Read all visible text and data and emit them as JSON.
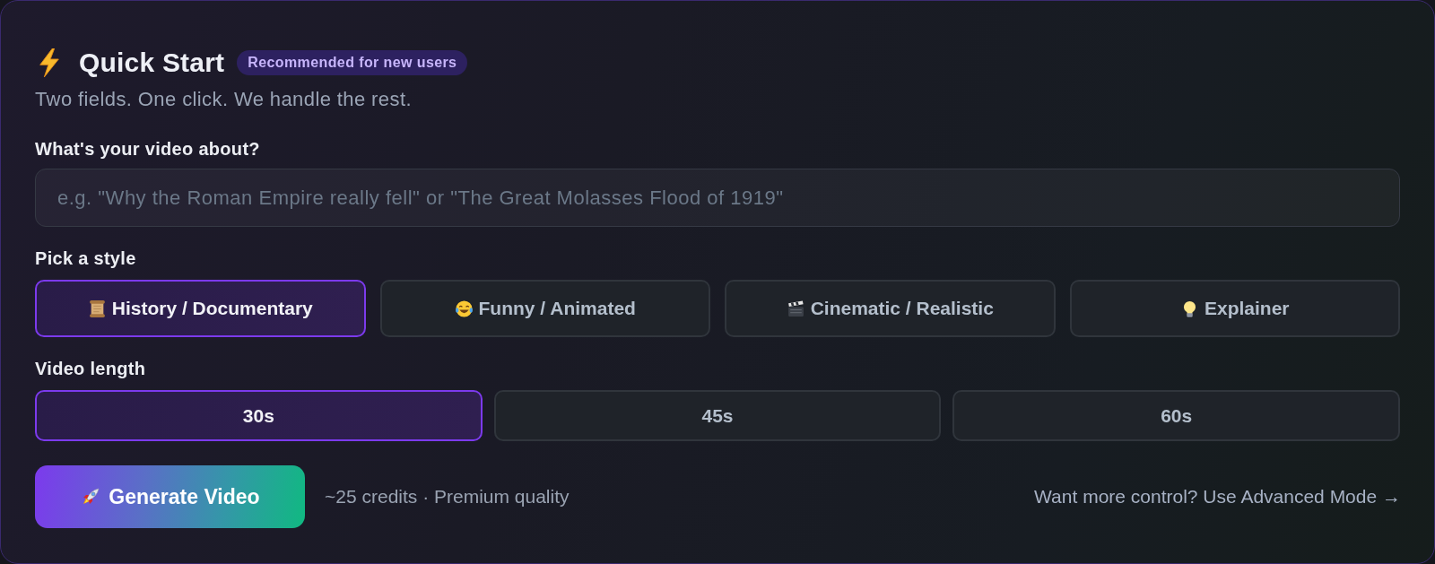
{
  "header": {
    "title": "Quick Start",
    "badge": "Recommended for new users",
    "subtitle": "Two fields. One click. We handle the rest."
  },
  "topic": {
    "label": "What's your video about?",
    "placeholder": "e.g. \"Why the Roman Empire really fell\" or \"The Great Molasses Flood of 1919\""
  },
  "style": {
    "label": "Pick a style",
    "options": [
      {
        "label": "History / Documentary",
        "selected": true
      },
      {
        "label": "Funny / Animated",
        "selected": false
      },
      {
        "label": "Cinematic / Realistic",
        "selected": false
      },
      {
        "label": "Explainer",
        "selected": false
      }
    ]
  },
  "length": {
    "label": "Video length",
    "options": [
      {
        "label": "30s",
        "selected": true
      },
      {
        "label": "45s",
        "selected": false
      },
      {
        "label": "60s",
        "selected": false
      }
    ]
  },
  "footer": {
    "generate_button": "Generate Video",
    "cost_note": "~25 credits · Premium quality",
    "advanced_link": "Want more control? Use Advanced Mode →"
  }
}
